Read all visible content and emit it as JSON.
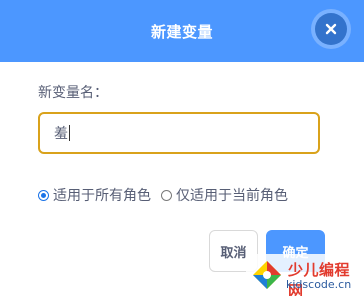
{
  "dialog": {
    "title": "新建变量",
    "close_icon": "close-icon"
  },
  "form": {
    "label": "新变量名：",
    "input_value": "羞"
  },
  "scope": {
    "options": [
      {
        "label": "适用于所有角色",
        "checked": true
      },
      {
        "label": "仅适用于当前角色",
        "checked": false
      }
    ]
  },
  "actions": {
    "cancel_label": "取消",
    "ok_label": "确定"
  },
  "watermark": {
    "name": "少儿编程网",
    "url": "kidscode.cn"
  },
  "colors": {
    "header": "#4c97ff",
    "close_bg": "#3373cc",
    "input_border": "#d9a21b",
    "radio_accent": "#1a73e8",
    "text": "#575e75"
  }
}
